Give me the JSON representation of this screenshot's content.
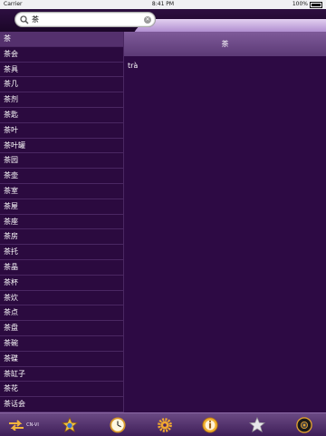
{
  "status": {
    "carrier": "Carrier",
    "time": "8:41 PM",
    "battery": "100%"
  },
  "search": {
    "query": "茶"
  },
  "words": [
    "茶",
    "茶会",
    "茶具",
    "茶几",
    "茶剂",
    "茶匙",
    "茶叶",
    "茶叶罐",
    "茶园",
    "茶壶",
    "茶室",
    "茶屋",
    "茶座",
    "茶房",
    "茶托",
    "茶晶",
    "茶杯",
    "茶炊",
    "茶点",
    "茶盘",
    "茶碗",
    "茶碟",
    "茶缸子",
    "茶花",
    "茶话会"
  ],
  "selected_index": 0,
  "detail": {
    "headword": "茶",
    "meaning": "trà"
  },
  "tabbar": {
    "lang_label": "CN-VI"
  },
  "colors": {
    "accent": "#e3a83a",
    "panel": "#2d0a44",
    "header": "#6c4a86"
  }
}
